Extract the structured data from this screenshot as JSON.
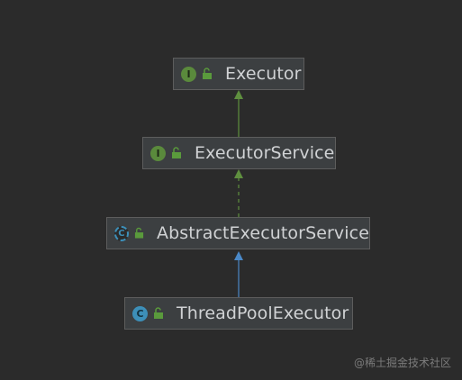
{
  "diagram": {
    "nodes": [
      {
        "id": "executor",
        "label": "Executor",
        "kind": "interface"
      },
      {
        "id": "executorservice",
        "label": "ExecutorService",
        "kind": "interface"
      },
      {
        "id": "abstract",
        "label": "AbstractExecutorService",
        "kind": "abstract-class"
      },
      {
        "id": "threadpool",
        "label": "ThreadPoolExecutor",
        "kind": "class"
      }
    ],
    "edges": [
      {
        "from": "executorservice",
        "to": "executor",
        "type": "extends",
        "style": "solid",
        "color": "#5f8f3f"
      },
      {
        "from": "abstract",
        "to": "executorservice",
        "type": "implements",
        "style": "dashed",
        "color": "#5f8f3f"
      },
      {
        "from": "threadpool",
        "to": "abstract",
        "type": "extends",
        "style": "solid",
        "color": "#4a88c7"
      }
    ],
    "badges": {
      "interface": "I",
      "class": "C",
      "abstract-class": "C"
    },
    "icons": {
      "visibility": "lock-open-icon"
    }
  },
  "watermark": "@稀土掘金技术社区",
  "colors": {
    "background": "#2b2b2b",
    "node_fill": "#3c3f41",
    "node_border": "#5d5d5d",
    "text": "#d0d2d4",
    "interface_badge": "#5a8a3c",
    "class_badge": "#3d8fb8"
  }
}
